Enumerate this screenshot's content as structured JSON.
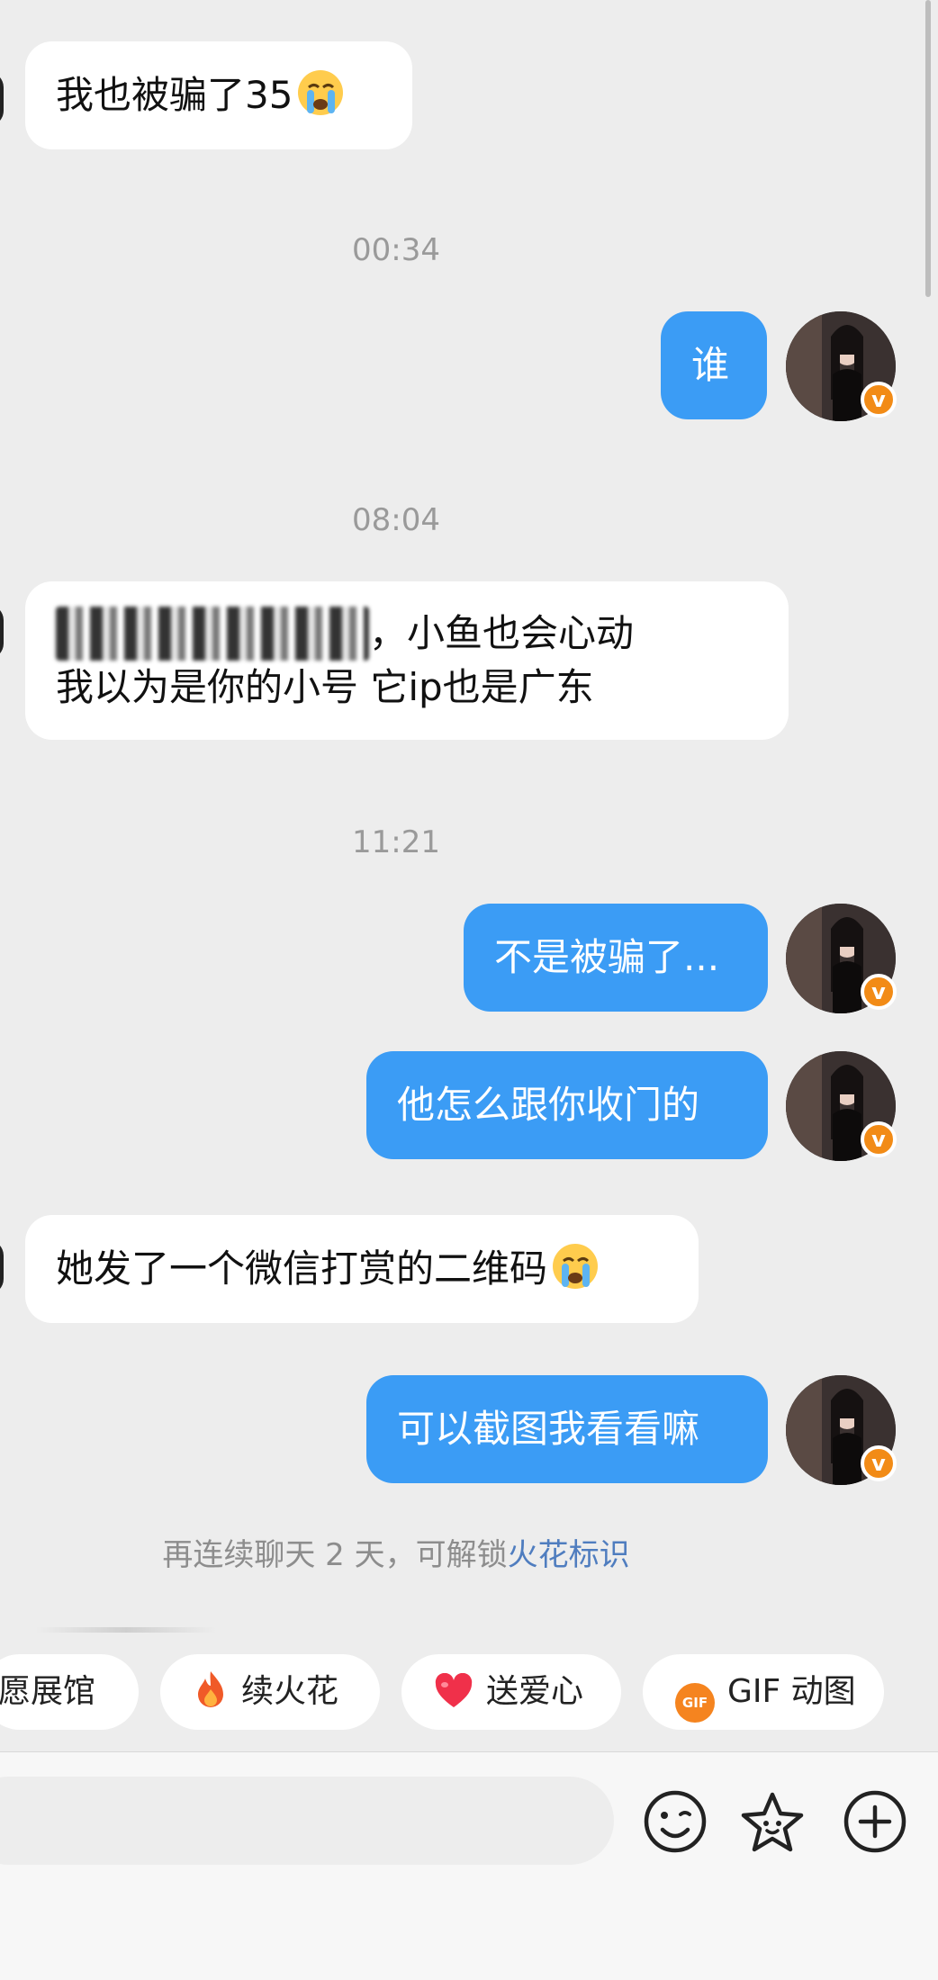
{
  "messages": [
    {
      "text": "我也被骗了35",
      "emoji": "crying-face"
    },
    {
      "time": "00:34"
    },
    {
      "text": "谁"
    },
    {
      "time": "08:04"
    },
    {
      "line1_visible": "，小鱼也会心动",
      "line2": "我以为是你的小号  它ip也是广东"
    },
    {
      "time": "11:21"
    },
    {
      "text": "不是被骗了..."
    },
    {
      "text": "他怎么跟你收门的"
    },
    {
      "text": "她发了一个微信打赏的二维码",
      "emoji": "crying-face"
    },
    {
      "text": "可以截图我看看嘛"
    }
  ],
  "hint": {
    "prefix": "再连续聊天 2 天，可解锁",
    "link": "火花标识"
  },
  "chips": [
    {
      "label": "愿展馆"
    },
    {
      "label": "续火花",
      "icon": "flame-icon"
    },
    {
      "label": "送爱心",
      "icon": "heart-icon"
    },
    {
      "label": "GIF 动图",
      "icon": "gif-icon",
      "icon_text": "GIF"
    }
  ],
  "badge": "v",
  "colors": {
    "outgoing": "#3b9cf5",
    "incoming": "#ffffff",
    "background": "#ededed",
    "link": "#4f7dbf",
    "badge": "#f28b16"
  }
}
